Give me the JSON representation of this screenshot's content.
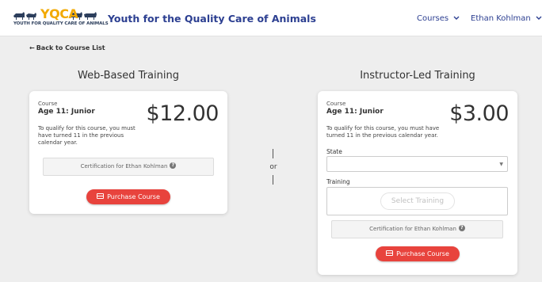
{
  "header": {
    "logo_text": "YQCA",
    "logo_tagline": "YOUTH FOR QUALITY CARE OF ANIMALS",
    "site_title": "Youth for the Quality Care of Animals",
    "nav": [
      {
        "label": "Courses",
        "icon": "chevron-down-icon"
      },
      {
        "label": "Ethan Kohlman",
        "icon": "chevron-down-icon"
      }
    ],
    "colors": {
      "brand_blue": "#2c3f91",
      "brand_gold": "#f2a900",
      "button_red": "#e8433d"
    }
  },
  "back_link": {
    "arrow": "←",
    "label": "Back to Course List"
  },
  "web_training": {
    "heading": "Web-Based Training",
    "course_label": "Course",
    "course_name": "Age 11: Junior",
    "price": "$12.00",
    "description": "To qualify for this course, you must have turned 11 in the previous calendar year.",
    "certification": "Certification for Ethan Kohlman",
    "help_icon": "?",
    "purchase_label": "Purchase Course"
  },
  "divider": {
    "label": "or"
  },
  "instructor_training": {
    "heading": "Instructor-Led Training",
    "course_label": "Course",
    "course_name": "Age 11: Junior",
    "price": "$3.00",
    "description": "To qualify for this course, you must have turned 11 in the previous calendar year.",
    "state_label": "State",
    "state_value": "",
    "training_label": "Training",
    "select_training_label": "Select Training",
    "certification": "Certification for Ethan Kohlman",
    "help_icon": "?",
    "purchase_label": "Purchase Course"
  }
}
